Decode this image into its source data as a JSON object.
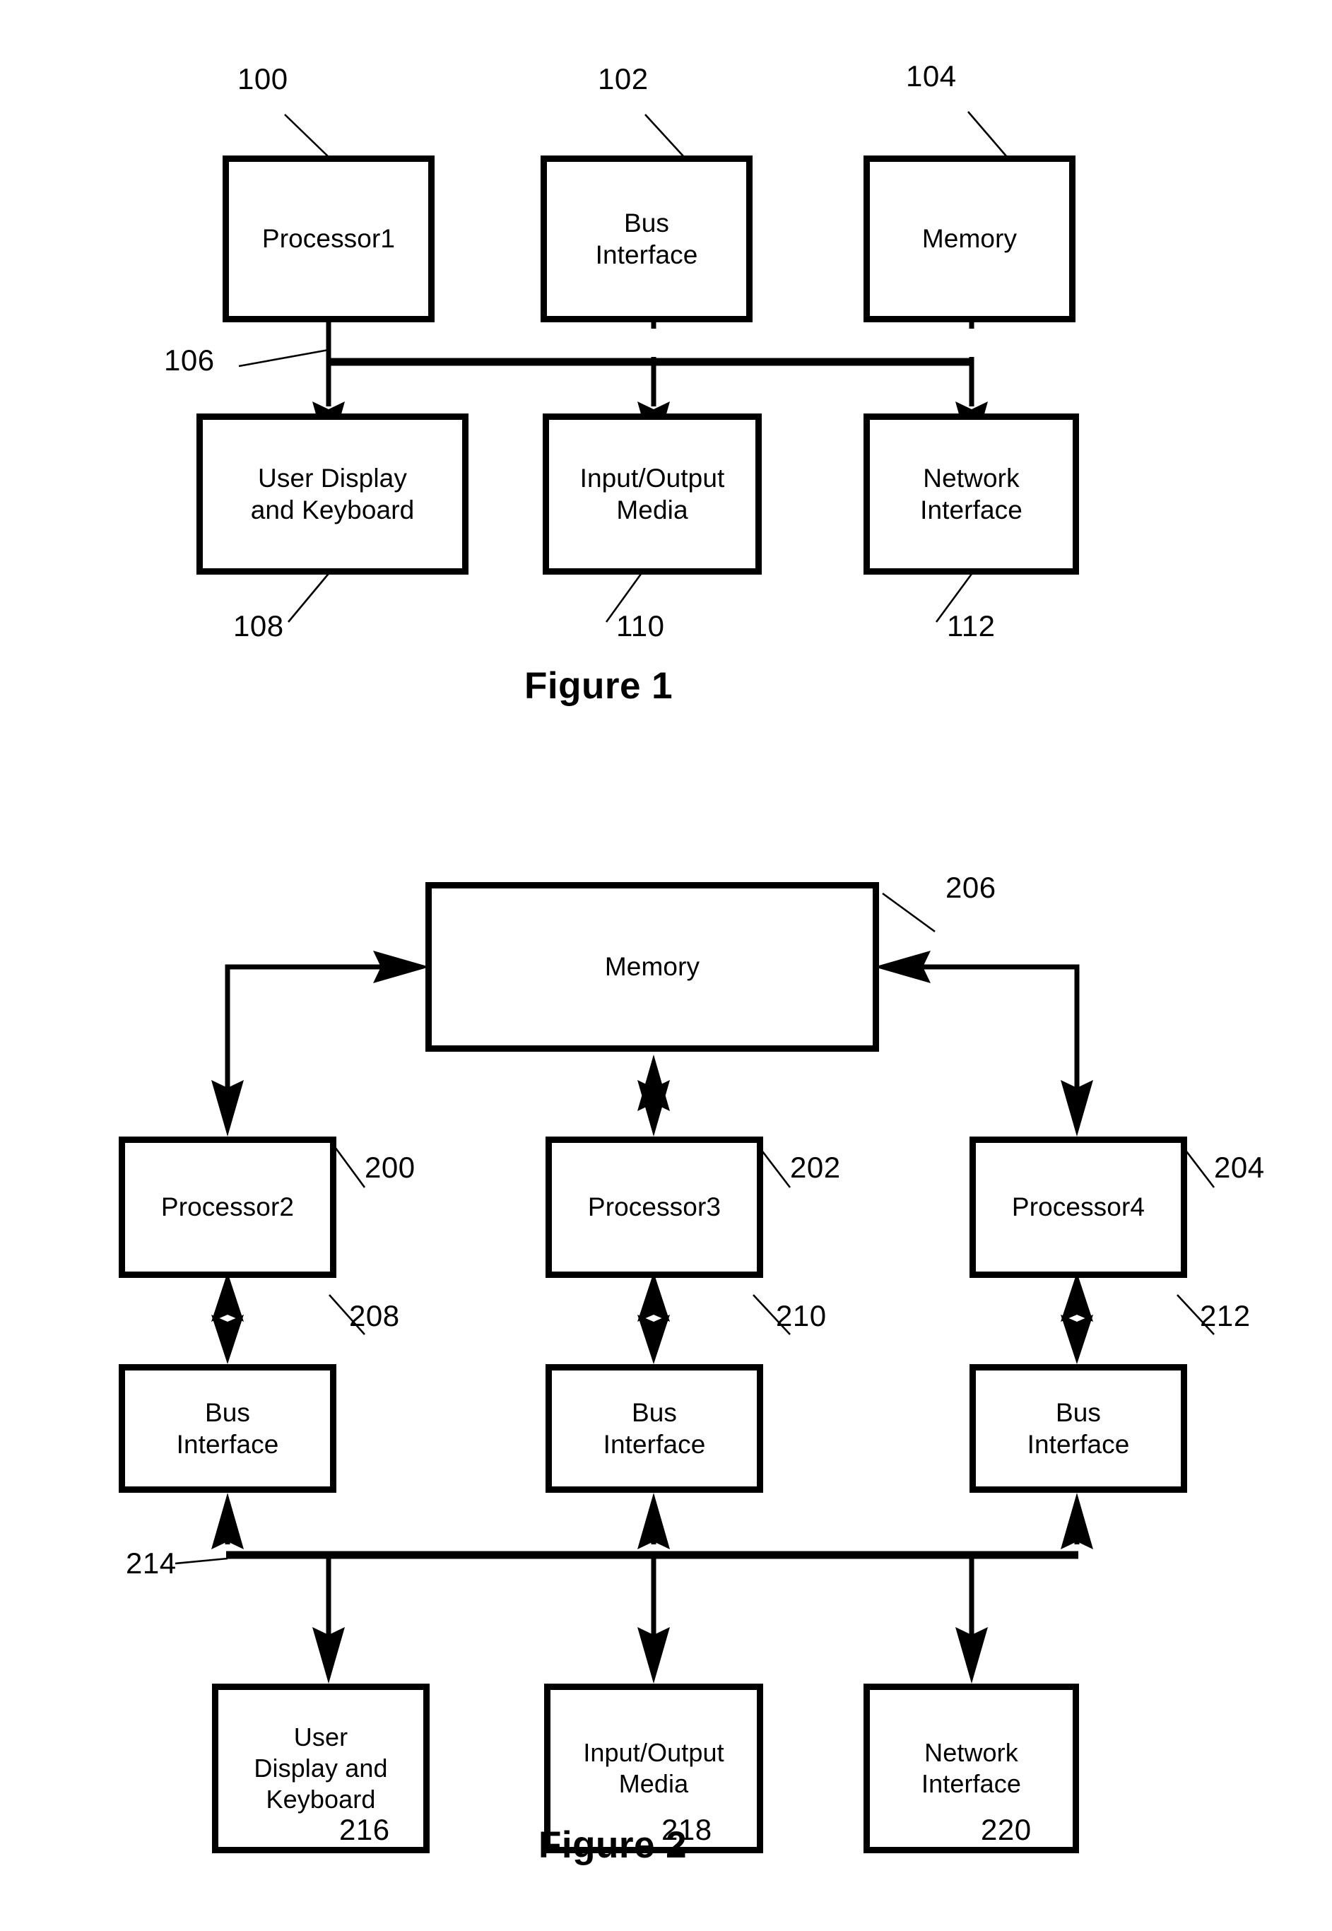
{
  "figures": [
    {
      "id": "figure-1",
      "caption": "Figure 1",
      "nodes": [
        {
          "key": "processor1",
          "label": "Processor1",
          "ref": "100"
        },
        {
          "key": "bus_if",
          "label": "Bus\nInterface",
          "ref": "102"
        },
        {
          "key": "memory",
          "label": "Memory",
          "ref": "104"
        },
        {
          "key": "user_display",
          "label": "User Display\nand Keyboard",
          "ref": "108"
        },
        {
          "key": "io_media",
          "label": "Input/Output\nMedia",
          "ref": "110"
        },
        {
          "key": "network_if",
          "label": "Network\nInterface",
          "ref": "112"
        }
      ],
      "bus": {
        "key": "system-bus",
        "ref": "106"
      }
    },
    {
      "id": "figure-2",
      "caption": "Figure 2",
      "nodes": [
        {
          "key": "memory",
          "label": "Memory",
          "ref": "206"
        },
        {
          "key": "processor2",
          "label": "Processor2",
          "ref": "200"
        },
        {
          "key": "processor3",
          "label": "Processor3",
          "ref": "202"
        },
        {
          "key": "processor4",
          "label": "Processor4",
          "ref": "204"
        },
        {
          "key": "bus_if_1",
          "label": "Bus\nInterface",
          "ref": "208"
        },
        {
          "key": "bus_if_2",
          "label": "Bus\nInterface",
          "ref": "210"
        },
        {
          "key": "bus_if_3",
          "label": "Bus\nInterface",
          "ref": "212"
        },
        {
          "key": "user_display",
          "label": "User\nDisplay and\nKeyboard",
          "ref": "216"
        },
        {
          "key": "io_media",
          "label": "Input/Output\nMedia",
          "ref": "218"
        },
        {
          "key": "network_if",
          "label": "Network\nInterface",
          "ref": "220"
        }
      ],
      "bus": {
        "key": "system-bus",
        "ref": "214"
      }
    }
  ],
  "fig1": {
    "caption": "Figure 1",
    "processor1": "Processor1",
    "processor1_ref": "100",
    "bus_interface": "Bus\nInterface",
    "bus_interface_ref": "102",
    "memory": "Memory",
    "memory_ref": "104",
    "user_display": "User Display\nand Keyboard",
    "user_display_ref": "108",
    "io_media": "Input/Output\nMedia",
    "io_media_ref": "110",
    "network_interface": "Network\nInterface",
    "network_interface_ref": "112",
    "bus_ref": "106"
  },
  "fig2": {
    "caption": "Figure 2",
    "memory": "Memory",
    "memory_ref": "206",
    "processor2": "Processor2",
    "processor2_ref": "200",
    "processor3": "Processor3",
    "processor3_ref": "202",
    "processor4": "Processor4",
    "processor4_ref": "204",
    "bus_interface_1": "Bus\nInterface",
    "bus_interface_1_ref": "208",
    "bus_interface_2": "Bus\nInterface",
    "bus_interface_2_ref": "210",
    "bus_interface_3": "Bus\nInterface",
    "bus_interface_3_ref": "212",
    "user_display": "User\nDisplay and\nKeyboard",
    "user_display_ref": "216",
    "io_media": "Input/Output\nMedia",
    "io_media_ref": "218",
    "network_interface": "Network\nInterface",
    "network_interface_ref": "220",
    "bus_ref": "214"
  },
  "colors": {
    "ink": "#000000",
    "paper": "#ffffff"
  }
}
